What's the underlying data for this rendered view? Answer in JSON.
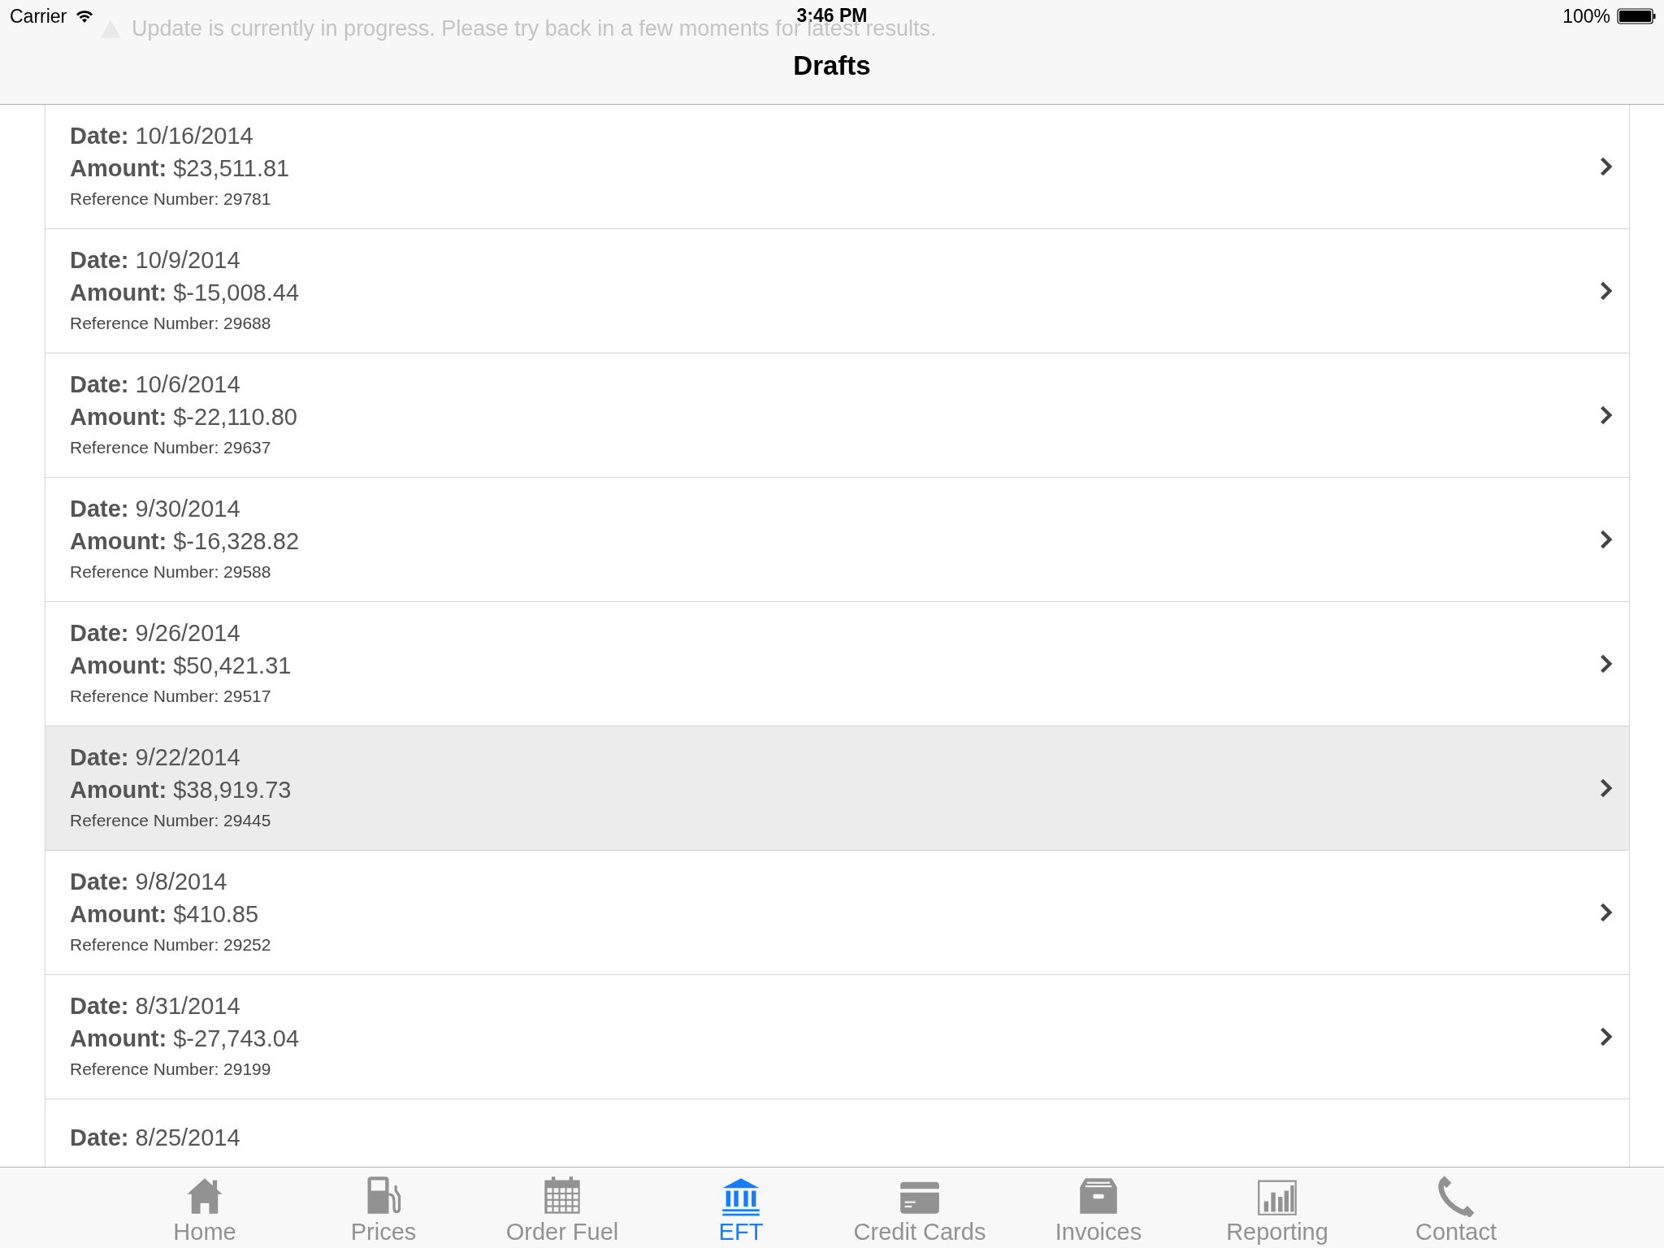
{
  "status_bar": {
    "carrier": "Carrier",
    "time": "3:46 PM",
    "battery": "100%"
  },
  "banner": {
    "text": "Update is currently in progress. Please try back in a few moments for latest results."
  },
  "nav": {
    "title": "Drafts"
  },
  "drafts": [
    {
      "date_label": "Date:",
      "date": "10/16/2014",
      "amount_label": "Amount:",
      "amount": "$23,511.81",
      "reference": "Reference Number: 29781",
      "selected": false
    },
    {
      "date_label": "Date:",
      "date": "10/9/2014",
      "amount_label": "Amount:",
      "amount": "$-15,008.44",
      "reference": "Reference Number: 29688",
      "selected": false
    },
    {
      "date_label": "Date:",
      "date": "10/6/2014",
      "amount_label": "Amount:",
      "amount": "$-22,110.80",
      "reference": "Reference Number: 29637",
      "selected": false
    },
    {
      "date_label": "Date:",
      "date": "9/30/2014",
      "amount_label": "Amount:",
      "amount": "$-16,328.82",
      "reference": "Reference Number: 29588",
      "selected": false
    },
    {
      "date_label": "Date:",
      "date": "9/26/2014",
      "amount_label": "Amount:",
      "amount": "$50,421.31",
      "reference": "Reference Number: 29517",
      "selected": false
    },
    {
      "date_label": "Date:",
      "date": "9/22/2014",
      "amount_label": "Amount:",
      "amount": "$38,919.73",
      "reference": "Reference Number: 29445",
      "selected": true
    },
    {
      "date_label": "Date:",
      "date": "9/8/2014",
      "amount_label": "Amount:",
      "amount": "$410.85",
      "reference": "Reference Number: 29252",
      "selected": false
    },
    {
      "date_label": "Date:",
      "date": "8/31/2014",
      "amount_label": "Amount:",
      "amount": "$-27,743.04",
      "reference": "Reference Number: 29199",
      "selected": false
    },
    {
      "date_label": "Date:",
      "date": "8/25/2014",
      "selected": false
    }
  ],
  "tabs": [
    {
      "label": "Home",
      "kind": "home",
      "selected": false
    },
    {
      "label": "Prices",
      "kind": "fuel",
      "selected": false
    },
    {
      "label": "Order Fuel",
      "kind": "calendar",
      "selected": false
    },
    {
      "label": "EFT",
      "kind": "bank",
      "selected": true
    },
    {
      "label": "Credit Cards",
      "kind": "card",
      "selected": false
    },
    {
      "label": "Invoices",
      "kind": "box",
      "selected": false
    },
    {
      "label": "Reporting",
      "kind": "chart",
      "selected": false
    },
    {
      "label": "Contact",
      "kind": "phone",
      "selected": false
    }
  ]
}
